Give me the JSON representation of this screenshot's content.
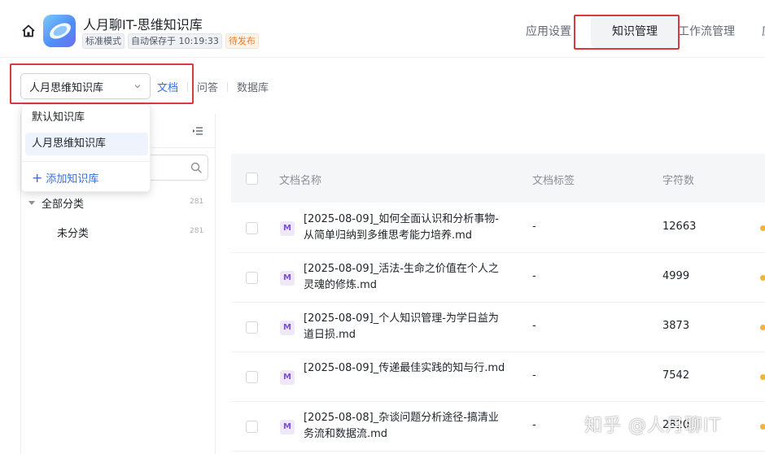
{
  "header": {
    "title": "人月聊IT-思维知识库",
    "mode_badge": "标准模式",
    "autosave": "自动保存于 10:19:33",
    "status_badge": "待发布",
    "tabs": [
      {
        "label": "应用设置"
      },
      {
        "label": "知识管理",
        "active": true
      },
      {
        "label": "工作流管理"
      },
      {
        "label": "应"
      }
    ]
  },
  "kb_selector": {
    "value": "人月思维知识库",
    "options": [
      "默认知识库",
      "人月思维知识库"
    ],
    "add_label": "添加知识库"
  },
  "sub_tabs": [
    {
      "label": "文档",
      "active": true
    },
    {
      "label": "问答"
    },
    {
      "label": "数据库"
    }
  ],
  "sidebar": {
    "tree": [
      {
        "label": "全部分类",
        "count": "281"
      },
      {
        "label": "未分类",
        "count": "281"
      }
    ]
  },
  "table": {
    "columns": [
      "文档名称",
      "文档标签",
      "字符数"
    ],
    "rows": [
      {
        "name": "[2025-08-09]_如何全面认识和分析事物-从简单归纳到多维思考能力培养.md",
        "tag": "-",
        "chars": "12663"
      },
      {
        "name": "[2025-08-09]_活法-生命之价值在个人之灵魂的修炼.md",
        "tag": "-",
        "chars": "4999"
      },
      {
        "name": "[2025-08-09]_个人知识管理-为学日益为道日损.md",
        "tag": "-",
        "chars": "3873"
      },
      {
        "name": "[2025-08-09]_传递最佳实践的知与行.md",
        "tag": "-",
        "chars": "7542"
      },
      {
        "name": "[2025-08-08]_杂谈问题分析途径-搞清业务流和数据流.md",
        "tag": "-",
        "chars": "2820"
      }
    ]
  },
  "watermark": "知乎 @人月聊IT",
  "colors": {
    "accent": "#3a6fd8",
    "highlight_box": "#d9393f",
    "status_orange": "#f07d22",
    "md_icon": "#7b4fd6"
  }
}
